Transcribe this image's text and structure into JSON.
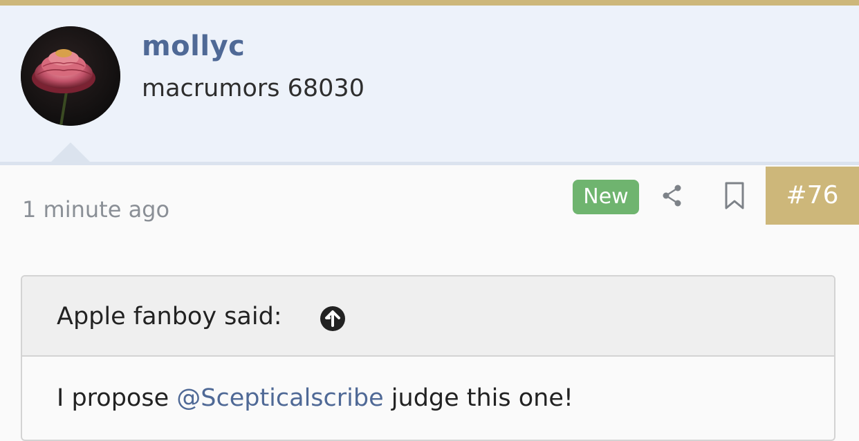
{
  "post": {
    "author": {
      "username": "mollyc",
      "title": "macrumors 68030",
      "avatar": "zinnia-flower-avatar"
    },
    "timestamp": "1 minute ago",
    "badge": "New",
    "number": "#76",
    "icons": {
      "share": "share-icon",
      "bookmark": "bookmark-icon",
      "quote_arrow": "arrow-up-circle-icon"
    },
    "quote": {
      "attribution": "Apple fanboy said:",
      "body_prefix": "I propose ",
      "mention": "@Scepticalscribe",
      "body_suffix": " judge this one!"
    }
  },
  "colors": {
    "accent_gold": "#cdb77a",
    "header_bg": "#edf2fa",
    "username_blue": "#4f6996",
    "new_badge_green": "#6fb46f"
  }
}
